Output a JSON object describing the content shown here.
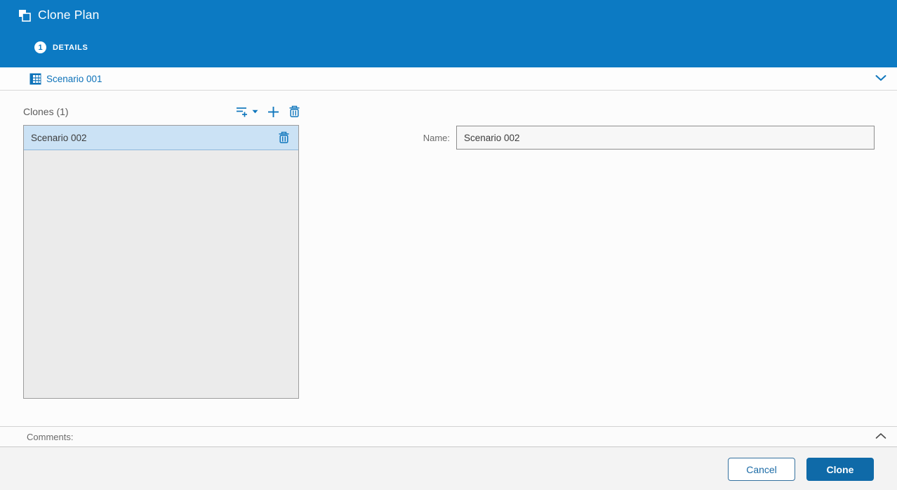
{
  "header": {
    "title": "Clone Plan",
    "step_number": "1",
    "step_label": "DETAILS"
  },
  "scenario_bar": {
    "label": "Scenario 001"
  },
  "clones": {
    "heading": "Clones (1)",
    "items": [
      {
        "name": "Scenario 002"
      }
    ]
  },
  "form": {
    "name_label": "Name:",
    "name_value": "Scenario 002"
  },
  "comments": {
    "label": "Comments:"
  },
  "footer": {
    "cancel_label": "Cancel",
    "clone_label": "Clone"
  },
  "icons": {
    "clone": "clone-icon",
    "scenario_table": "table-icon",
    "add_multiple": "add-multiple-icon",
    "add": "plus-icon",
    "delete": "trash-icon",
    "collapse": "chevron-up-icon",
    "expand": "chevron-down-icon"
  },
  "colors": {
    "header_blue": "#0c7ac3",
    "accent_blue": "#0d72b9",
    "icon_blue": "#1077bd",
    "clone_button_blue": "#0f6aa8",
    "selected_row_blue": "#cbe2f5",
    "panel_gray": "#ebebeb",
    "footer_gray": "#f3f3f3"
  }
}
